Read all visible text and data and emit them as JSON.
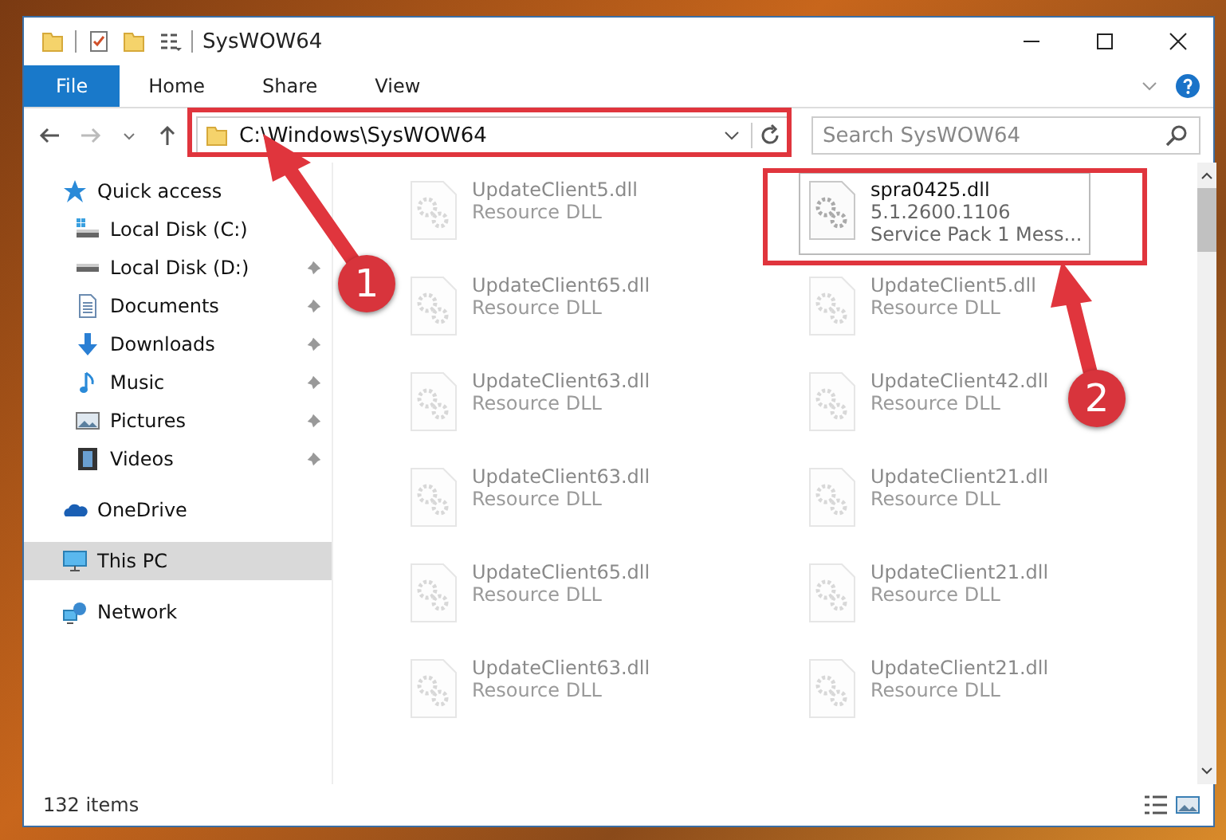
{
  "window": {
    "title": "SysWOW64"
  },
  "ribbon": {
    "tabs": [
      {
        "label": "File",
        "selected": true
      },
      {
        "label": "Home",
        "selected": false
      },
      {
        "label": "Share",
        "selected": false
      },
      {
        "label": "View",
        "selected": false
      }
    ]
  },
  "address_bar": {
    "path": "C:\\Windows\\SysWOW64"
  },
  "search": {
    "placeholder": "Search SysWOW64"
  },
  "sidebar": {
    "items": [
      {
        "label": "Quick access",
        "kind": "star",
        "selected": false,
        "children": [
          {
            "label": "Local Disk (C:)",
            "kind": "windrive",
            "pinned": false,
            "selected": false
          },
          {
            "label": "Local Disk (D:)",
            "kind": "drive",
            "pinned": true,
            "selected": false
          },
          {
            "label": "Documents",
            "kind": "documents",
            "pinned": true,
            "selected": false
          },
          {
            "label": "Downloads",
            "kind": "downloads",
            "pinned": true,
            "selected": false
          },
          {
            "label": "Music",
            "kind": "music",
            "pinned": true,
            "selected": false
          },
          {
            "label": "Pictures",
            "kind": "pictures",
            "pinned": true,
            "selected": false
          },
          {
            "label": "Videos",
            "kind": "videos",
            "pinned": true,
            "selected": false
          }
        ]
      },
      {
        "label": "OneDrive",
        "kind": "cloud",
        "selected": false
      },
      {
        "label": "This PC",
        "kind": "pc",
        "selected": true
      },
      {
        "label": "Network",
        "kind": "network",
        "selected": false
      }
    ]
  },
  "files": [
    {
      "name": "UpdateClient5.dll",
      "details": [
        "Resource DLL"
      ],
      "selected": false
    },
    {
      "name": "spra0425.dll",
      "details": [
        "5.1.2600.1106",
        "Service Pack 1 Mess..."
      ],
      "selected": true
    },
    {
      "name": "UpdateClient65.dll",
      "details": [
        "Resource DLL"
      ],
      "selected": false
    },
    {
      "name": "UpdateClient5.dll",
      "details": [
        "Resource DLL"
      ],
      "selected": false
    },
    {
      "name": "UpdateClient63.dll",
      "details": [
        "Resource DLL"
      ],
      "selected": false
    },
    {
      "name": "UpdateClient42.dll",
      "details": [
        "Resource DLL"
      ],
      "selected": false
    },
    {
      "name": "UpdateClient63.dll",
      "details": [
        "Resource DLL"
      ],
      "selected": false
    },
    {
      "name": "UpdateClient21.dll",
      "details": [
        "Resource DLL"
      ],
      "selected": false
    },
    {
      "name": "UpdateClient65.dll",
      "details": [
        "Resource DLL"
      ],
      "selected": false
    },
    {
      "name": "UpdateClient21.dll",
      "details": [
        "Resource DLL"
      ],
      "selected": false
    },
    {
      "name": "UpdateClient63.dll",
      "details": [
        "Resource DLL"
      ],
      "selected": false
    },
    {
      "name": "UpdateClient21.dll",
      "details": [
        "Resource DLL"
      ],
      "selected": false
    }
  ],
  "status_bar": {
    "count": "132 items"
  },
  "annotations": [
    {
      "label": "1"
    },
    {
      "label": "2"
    }
  ]
}
